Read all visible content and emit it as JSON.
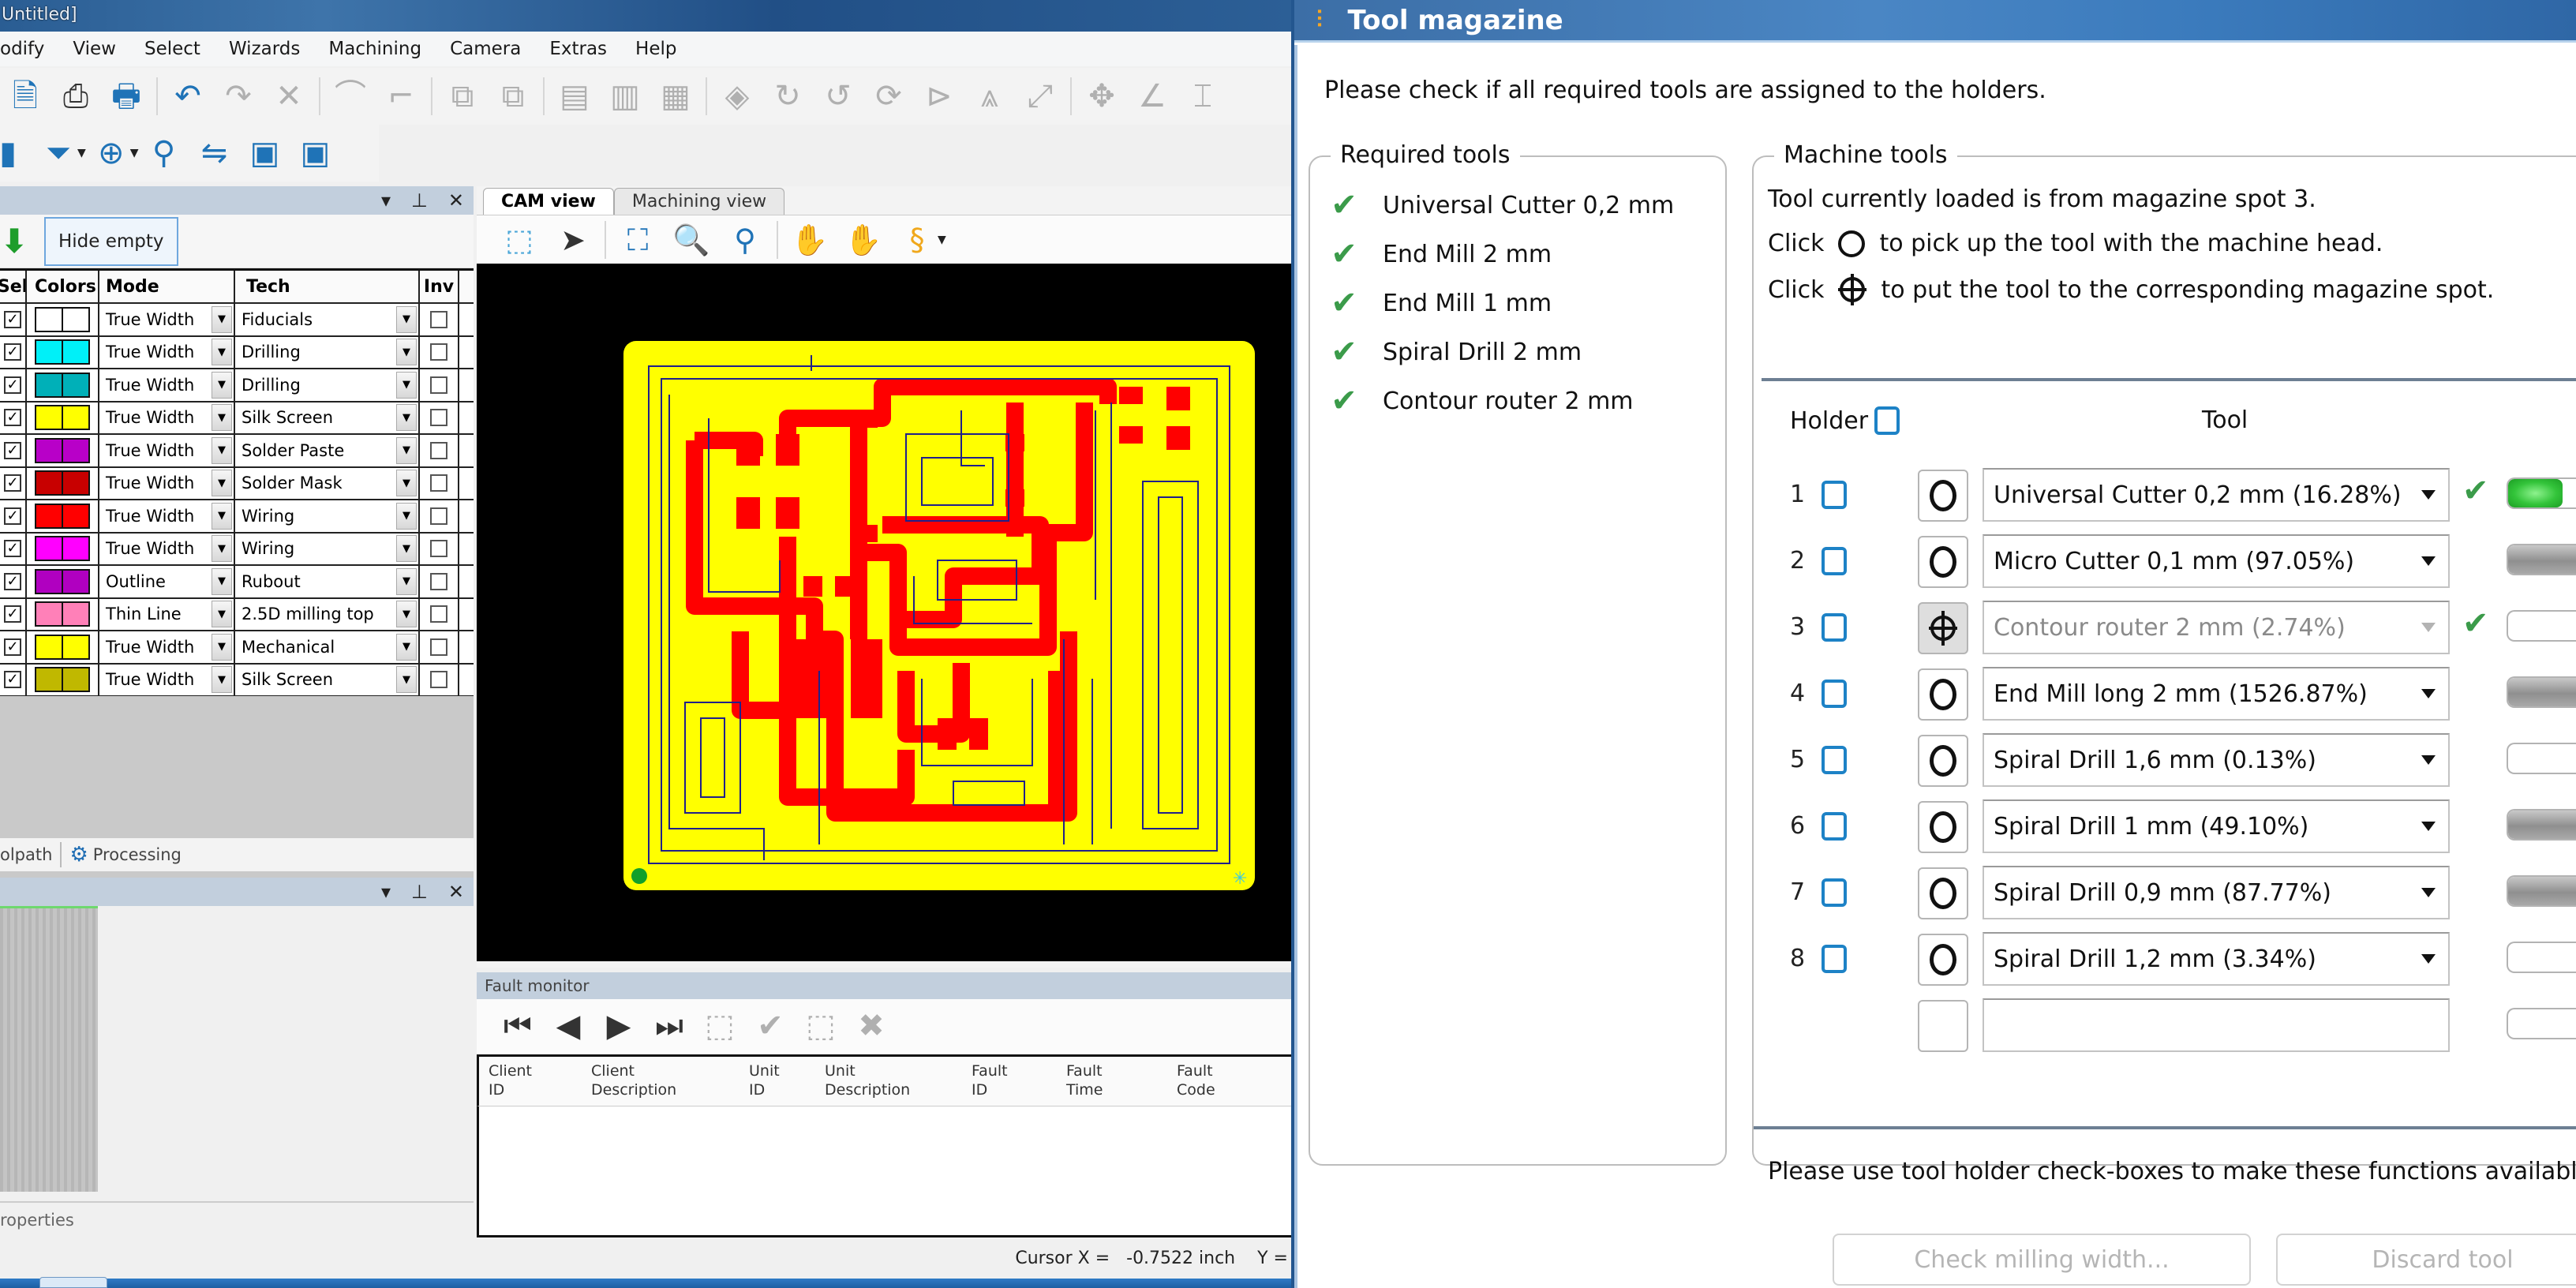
{
  "app": {
    "title": "Untitled]",
    "menu": [
      "odify",
      "View",
      "Select",
      "Wizards",
      "Machining",
      "Camera",
      "Extras",
      "Help"
    ],
    "toolbar1_icons": [
      "open-icon",
      "print-preview-icon",
      "print-icon",
      "undo-icon",
      "redo-icon",
      "delete-icon",
      "polyline-icon",
      "line-icon",
      "mirror-left-icon",
      "mirror-right-icon",
      "align-icon",
      "distribute-icon",
      "arrange-icon",
      "fill-icon",
      "rotate-cw-icon",
      "rotate-ccw-icon",
      "rotate-icon",
      "flip-icon",
      "scale-icon",
      "transform-icon",
      "move-icon",
      "angle-icon",
      "measure-icon"
    ],
    "toolbar2_icons": [
      "layer-icon",
      "isolation-icon",
      "target-icon",
      "tool-change-icon",
      "settings-icon",
      "camera-icon",
      "machine-icon"
    ]
  },
  "layers": {
    "hide_empty_label": "Hide empty",
    "columns": [
      "Sel",
      "Colors",
      "Mode",
      "Tech",
      "Inv"
    ],
    "rows": [
      {
        "checked": true,
        "color": "#ffffff",
        "mode": "True Width",
        "tech": "Fiducials",
        "inv": false
      },
      {
        "checked": true,
        "color": "#00f0f8",
        "mode": "True Width",
        "tech": "Drilling",
        "inv": false
      },
      {
        "checked": true,
        "color": "#00b0b8",
        "mode": "True Width",
        "tech": "Drilling",
        "inv": false
      },
      {
        "checked": true,
        "color": "#ffff00",
        "mode": "True Width",
        "tech": "Silk Screen",
        "inv": false
      },
      {
        "checked": true,
        "color": "#b800c8",
        "mode": "True Width",
        "tech": "Solder Paste",
        "inv": false
      },
      {
        "checked": true,
        "color": "#c80000",
        "mode": "True Width",
        "tech": "Solder Mask",
        "inv": false
      },
      {
        "checked": true,
        "color": "#ff0000",
        "mode": "True Width",
        "tech": "Wiring",
        "inv": false
      },
      {
        "checked": true,
        "color": "#ff00ff",
        "mode": "True Width",
        "tech": "Wiring",
        "inv": false
      },
      {
        "checked": true,
        "color": "#b000c0",
        "mode": "Outline",
        "tech": "Rubout",
        "inv": false
      },
      {
        "checked": true,
        "color": "#ff80b8",
        "mode": "Thin Line",
        "tech": "2.5D milling top",
        "inv": false
      },
      {
        "checked": true,
        "color": "#ffff00",
        "mode": "True Width",
        "tech": "Mechanical",
        "inv": false
      },
      {
        "checked": true,
        "color": "#c0b800",
        "mode": "True Width",
        "tech": "Silk Screen",
        "inv": false
      }
    ],
    "scroll_thumb_label": "III"
  },
  "panel_tabs": {
    "toolpath": "olpath",
    "processing": "Processing"
  },
  "properties_label": "roperties",
  "cam": {
    "tabs": [
      "CAM view",
      "Machining view"
    ],
    "toolbar_icons": [
      "select-region-icon",
      "pointer-icon",
      "zoom-fit-icon",
      "zoom-window-icon",
      "zoom-width-icon",
      "pan-icon",
      "pan-lock-icon",
      "snap-icon"
    ],
    "colors": {
      "background": "#000000",
      "board": "#ffff00",
      "copper": "#ff0000",
      "contour": "#20208a"
    }
  },
  "fault_monitor": {
    "title": "Fault monitor",
    "toolbar_icons": [
      "first-icon",
      "prev-icon",
      "next-icon",
      "last-icon",
      "select-ack-icon",
      "ack-icon",
      "select-delete-icon",
      "delete-icon"
    ],
    "columns": [
      "Client\nID",
      "Client\nDescription",
      "Unit\nID",
      "Unit\nDescription",
      "Fault\nID",
      "Fault\nTime",
      "Fault\nCode"
    ]
  },
  "status": {
    "cursor_x_label": "Cursor X =",
    "cursor_x_value": "-0.7522 inch",
    "cursor_y_label": "Y ="
  },
  "dialog": {
    "title": "Tool magazine",
    "intro": "Please check if all required tools are assigned to the holders.",
    "required_tools": {
      "title": "Required tools",
      "items": [
        {
          "name": "Universal Cutter 0,2 mm",
          "ok": true
        },
        {
          "name": "End Mill 2 mm",
          "ok": true
        },
        {
          "name": "End Mill 1 mm",
          "ok": true
        },
        {
          "name": "Spiral Drill   2 mm",
          "ok": true
        },
        {
          "name": "Contour router 2 mm",
          "ok": true
        }
      ]
    },
    "machine_tools": {
      "title": "Machine tools",
      "loaded_text": "Tool currently loaded is from magazine spot 3.",
      "click_label": "Click",
      "pick_text": "to pick up the tool with the machine head.",
      "put_text": "to put the tool to the corresponding magazine spot.",
      "holder_header": "Holder",
      "tool_header": "Tool",
      "holders": [
        {
          "num": "1",
          "tool": "Universal Cutter 0,2 mm (16.28%)",
          "action": "pick",
          "enabled": true,
          "ok": true,
          "wear_percent": 16.28,
          "bar": "green"
        },
        {
          "num": "2",
          "tool": "Micro Cutter 0,1 mm (97.05%)",
          "action": "pick",
          "enabled": true,
          "ok": false,
          "wear_percent": 97.05,
          "bar": "gray"
        },
        {
          "num": "3",
          "tool": "Contour router 2 mm (2.74%)",
          "action": "put",
          "enabled": false,
          "ok": true,
          "wear_percent": 2.74,
          "bar": "empty"
        },
        {
          "num": "4",
          "tool": "End Mill long 2 mm (1526.87%)",
          "action": "pick",
          "enabled": true,
          "ok": false,
          "wear_percent": 1526.87,
          "bar": "gray"
        },
        {
          "num": "5",
          "tool": "Spiral Drill   1,6 mm (0.13%)",
          "action": "pick",
          "enabled": true,
          "ok": false,
          "wear_percent": 0.13,
          "bar": "empty"
        },
        {
          "num": "6",
          "tool": "Spiral Drill   1 mm (49.10%)",
          "action": "pick",
          "enabled": true,
          "ok": false,
          "wear_percent": 49.1,
          "bar": "gray"
        },
        {
          "num": "7",
          "tool": "Spiral Drill   0,9 mm (87.77%)",
          "action": "pick",
          "enabled": true,
          "ok": false,
          "wear_percent": 87.77,
          "bar": "gray"
        },
        {
          "num": "8",
          "tool": "Spiral Drill   1,2 mm (3.34%)",
          "action": "pick",
          "enabled": true,
          "ok": false,
          "wear_percent": 3.34,
          "bar": "empty"
        },
        {
          "num": "",
          "tool": "",
          "action": "pick",
          "enabled": true,
          "ok": false,
          "wear_percent": 0,
          "bar": "empty"
        }
      ],
      "footer_hint": "Please use tool holder check-boxes to make these functions available.",
      "check_width_label": "Check milling width...",
      "discard_label": "Discard tool"
    },
    "colors": {
      "check_green": "#3b9b4a",
      "holder_blue": "#1d82c6"
    }
  }
}
